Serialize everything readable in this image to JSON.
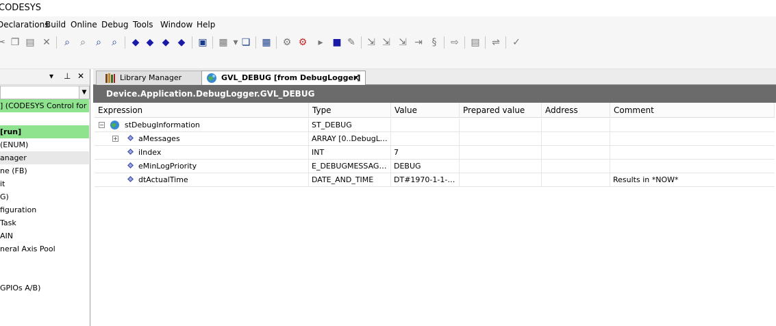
{
  "app": {
    "title": "CODESYS"
  },
  "menu": [
    "Declarations",
    "Build",
    "Online",
    "Debug",
    "Tools",
    "Window",
    "Help"
  ],
  "left_pane": {
    "tree": [
      {
        "label": "] (CODESYS Control for Raspberry Pi)",
        "style": "green"
      },
      {
        "label": " [run]",
        "style": "green-bold"
      },
      {
        "label": "(ENUM)",
        "style": ""
      },
      {
        "label": "anager",
        "style": "sel"
      },
      {
        "label": "ne (FB)",
        "style": ""
      },
      {
        "label": "it",
        "style": ""
      },
      {
        "label": "G)",
        "style": ""
      },
      {
        "label": "figuration",
        "style": ""
      },
      {
        "label": "Task",
        "style": ""
      },
      {
        "label": "AIN",
        "style": ""
      },
      {
        "label": "neral Axis Pool",
        "style": ""
      },
      {
        "label": "GPIOs A/B)",
        "style": ""
      }
    ]
  },
  "tabs": {
    "library_manager": "Library Manager",
    "gvl_debug": "GVL_DEBUG [from DebugLogger]"
  },
  "path": "Device.Application.DebugLogger.GVL_DEBUG",
  "grid": {
    "headers": {
      "expression": "Expression",
      "type": "Type",
      "value": "Value",
      "prepared": "Prepared value",
      "address": "Address",
      "comment": "Comment"
    },
    "rows": [
      {
        "expression": "stDebugInformation",
        "type": "ST_DEBUG",
        "value": "",
        "comment": ""
      },
      {
        "expression": "aMessages",
        "type": "ARRAY [0..DebugLo...",
        "value": "",
        "comment": ""
      },
      {
        "expression": "iIndex",
        "type": "INT",
        "value": "7",
        "comment": ""
      },
      {
        "expression": "eMinLogPriority",
        "type": "E_DEBUGMESSAGEP...",
        "value": "DEBUG",
        "comment": ""
      },
      {
        "expression": "dtActualTime",
        "type": "DATE_AND_TIME",
        "value": "DT#1970-1-1-0:...",
        "comment": "Results in *NOW*"
      }
    ]
  },
  "colors": {
    "run_green": "#8fe38f",
    "path_bar": "#6b6b6b"
  }
}
